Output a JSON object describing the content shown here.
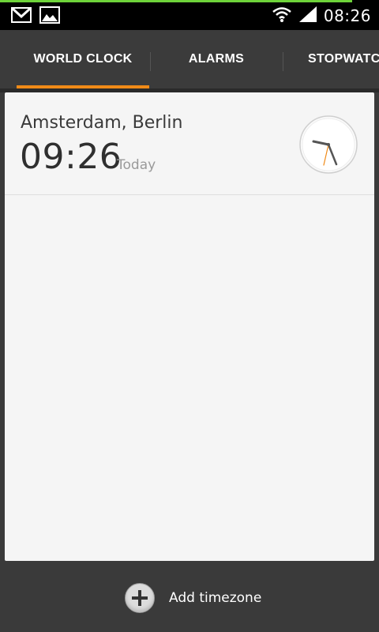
{
  "status_bar": {
    "time": "08:26",
    "icons": [
      "gmail-icon",
      "gallery-icon",
      "wifi-icon",
      "signal-icon"
    ]
  },
  "tabs": [
    {
      "label": "WORLD CLOCK",
      "active": true
    },
    {
      "label": "ALARMS",
      "active": false
    },
    {
      "label": "STOPWATCH",
      "active": false
    }
  ],
  "world_clock": {
    "entries": [
      {
        "city": "Amsterdam, Berlin",
        "time": "09:26",
        "day": "Today"
      }
    ]
  },
  "bottom_bar": {
    "add_label": "Add timezone"
  },
  "colors": {
    "accent": "#f08a17",
    "status_progress": "#6ed33a",
    "background": "#3a3a3a",
    "panel": "#f5f5f5"
  }
}
